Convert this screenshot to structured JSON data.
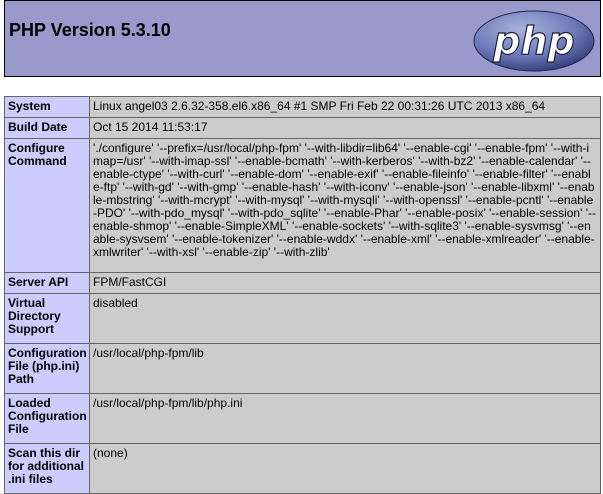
{
  "header": {
    "title": "PHP Version 5.3.10",
    "logo_text": "php"
  },
  "colors": {
    "header_bg": "#9999cc",
    "label_bg": "#ccccff",
    "value_bg": "#cccccc",
    "logo_fill": "#6c79b8"
  },
  "rows": [
    {
      "label": "System",
      "value": "Linux angel03 2.6.32-358.el6.x86_64 #1 SMP Fri Feb 22 00:31:26 UTC 2013 x86_64"
    },
    {
      "label": "Build Date",
      "value": "Oct 15 2014 11:53:17"
    },
    {
      "label": "Configure Command",
      "value": "'./configure' '--prefix=/usr/local/php-fpm' '--with-libdir=lib64' '--enable-cgi' '--enable-fpm' '--with-imap=/usr' '--with-imap-ssl' '--enable-bcmath' '--with-kerberos' '--with-bz2' '--enable-calendar' '--enable-ctype' '--with-curl' '--enable-dom' '--enable-exif' '--enable-fileinfo' '--enable-filter' '--enable-ftp' '--with-gd' '--with-gmp' '--enable-hash' '--with-iconv' '--enable-json' '--enable-libxml' '--enable-mbstring' '--with-mcrypt' '--with-mysql' '--with-mysqli' '--with-openssl' '--enable-pcntl' '--enable-PDO' '--with-pdo_mysql' '--with-pdo_sqlite' '--enable-Phar' '--enable-posix' '--enable-session' '--enable-shmop' '--enable-SimpleXML' '--enable-sockets' '--with-sqlite3' '--enable-sysvmsg' '--enable-sysvsem' '--enable-tokenizer' '--enable-wddx' '--enable-xml' '--enable-xmlreader' '--enable-xmlwriter' '--with-xsl' '--enable-zip' '--with-zlib'"
    },
    {
      "label": "Server API",
      "value": "FPM/FastCGI"
    },
    {
      "label": "Virtual Directory Support",
      "value": "disabled"
    },
    {
      "label": "Configuration File (php.ini) Path",
      "value": "/usr/local/php-fpm/lib"
    },
    {
      "label": "Loaded Configuration File",
      "value": "/usr/local/php-fpm/lib/php.ini"
    },
    {
      "label": "Scan this dir for additional .ini files",
      "value": "(none)"
    }
  ]
}
